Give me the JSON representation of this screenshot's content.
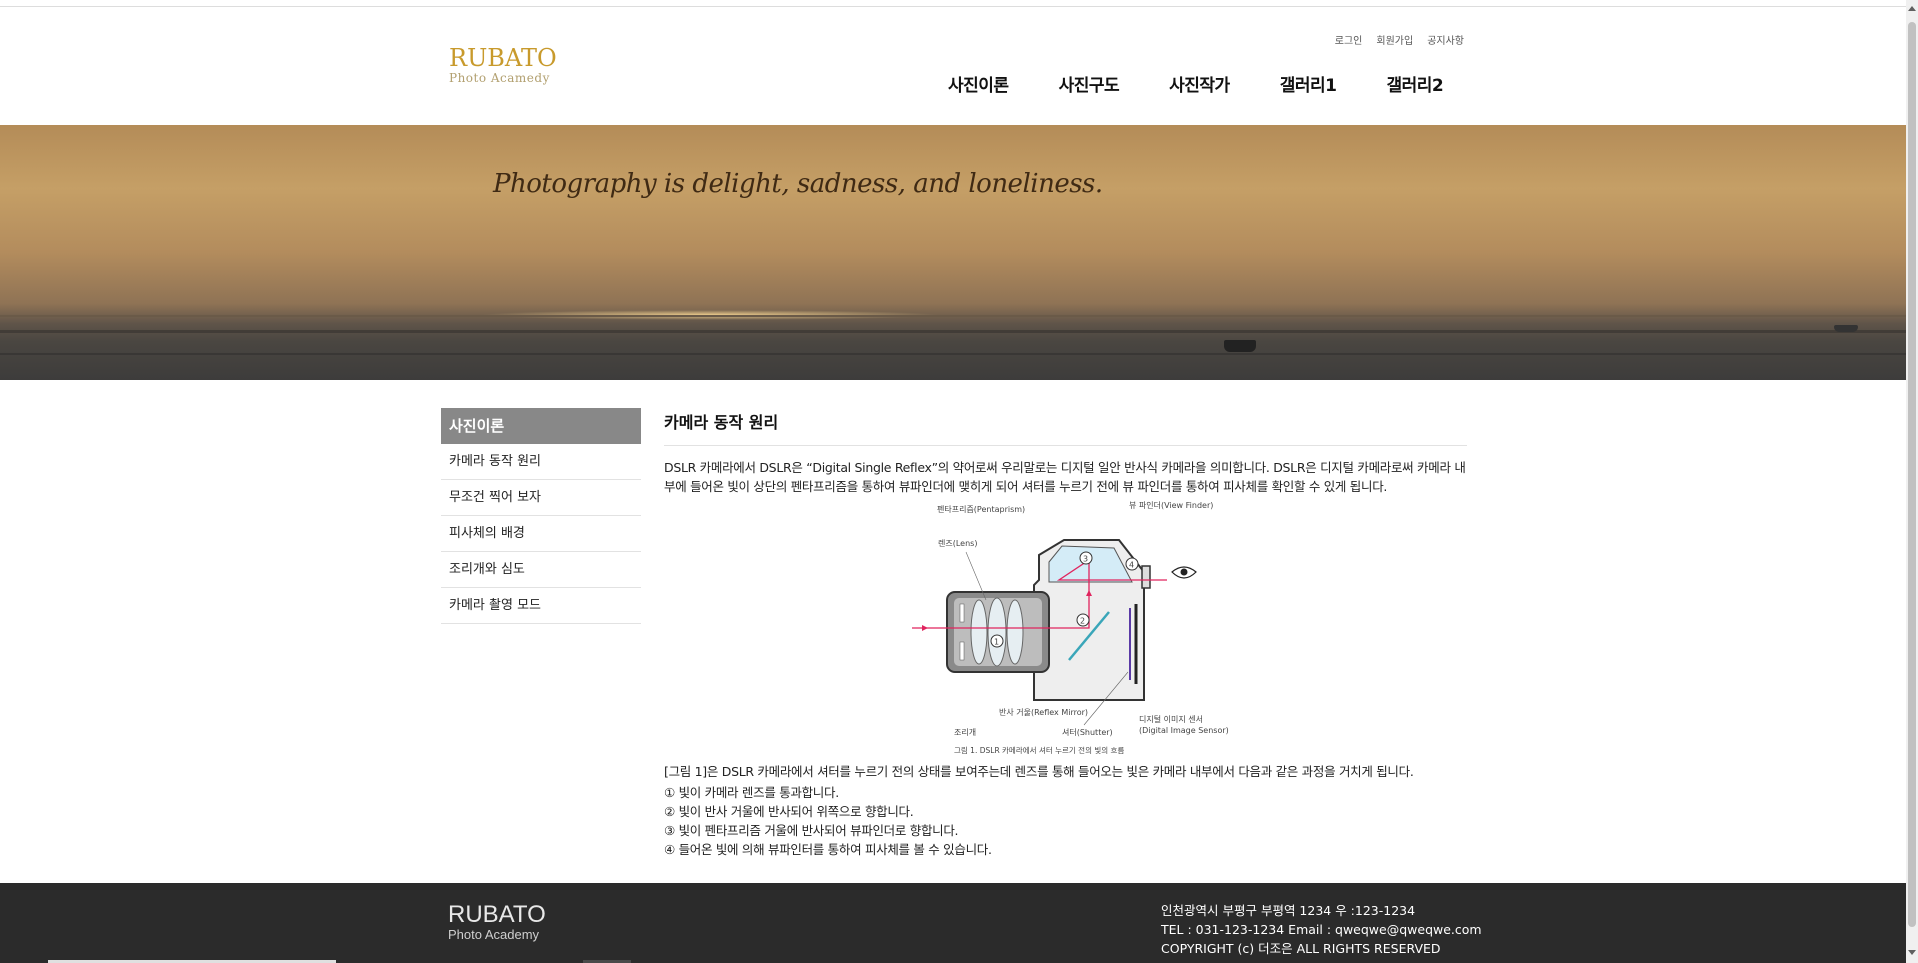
{
  "header": {
    "logo_main": "RUBATO",
    "logo_sub": "Photo Acamedy",
    "util_links": [
      "로그인",
      "회원가입",
      "공지사항"
    ],
    "nav": [
      "사진이론",
      "사진구도",
      "사진작가",
      "갤러리1",
      "갤러리2"
    ]
  },
  "banner": {
    "slogan": "Photography is delight, sadness, and loneliness."
  },
  "sidebar": {
    "title": "사진이론",
    "items": [
      "카메라 동작 원리",
      "무조건 찍어 보자",
      "피사체의 배경",
      "조리개와 심도",
      "카메라 촬영 모드"
    ]
  },
  "content": {
    "title": "카메라 동작 원리",
    "intro": "DSLR 카메라에서 DSLR은 “Digital Single Reflex”의 약어로써 우리말로는 디지털 일안 반사식 카메라을 의미합니다. DSLR은 디지털 카메라로써 카메라 내부에 들어온 빛이 상단의 펜타프리즘을 통하여 뷰파인더에 맺히게 되어 셔터를 누르기 전에 뷰 파인더를 통하여 피사체를 확인할 수 있게 됩니다.",
    "figure": {
      "label_pentaprism": "펜타프리즘(Pentaprism)",
      "label_viewfinder": "뷰 파인더(View Finder)",
      "label_lens": "렌즈(Lens)",
      "label_mirror": "반사 거울(Reflex Mirror)",
      "label_aperture": "조리개",
      "label_shutter": "셔터(Shutter)",
      "label_sensor_1": "디지털 이미지 센서",
      "label_sensor_2": "(Digital Image Sensor)",
      "caption": "그림 1. DSLR 카메라에서 셔터 누르기 전의 빛의 흐름",
      "num1": "1",
      "num2": "2",
      "num3": "3",
      "num4": "4"
    },
    "desc": "[그림 1]은 DSLR 카메라에서 셔터를 누르기 전의 상태를 보여주는데 렌즈를 통해 들어오는 빛은 카메라 내부에서 다음과 같은 과정을 거치게 됩니다.",
    "steps": [
      "① 빛이 카메라 렌즈를 통과합니다.",
      "② 빛이 반사 거울에 반사되어 위쪽으로 향합니다.",
      "③ 빛이 펜타프리즘 거울에 반사되어 뷰파인더로 향합니다.",
      "④ 들어온 빛에 의해 뷰파인터를 통하여 피사체를 볼 수 있습니다."
    ]
  },
  "footer": {
    "logo_main": "RUBATO",
    "logo_sub": "Photo Academy",
    "address": "인천광역시 부평구 부평역 1234 우 :123-1234",
    "contact": "TEL : 031-123-1234 Email : qweqwe@qweqwe.com",
    "copyright": "COPYRIGHT (c) 더조은 ALL RIGHTS RESERVED"
  },
  "colors": {
    "logo_gold": "#c89a2c",
    "sidebar_title_bg": "#888888",
    "footer_bg": "#2b2b2b",
    "light_ray": "#e0245e"
  }
}
